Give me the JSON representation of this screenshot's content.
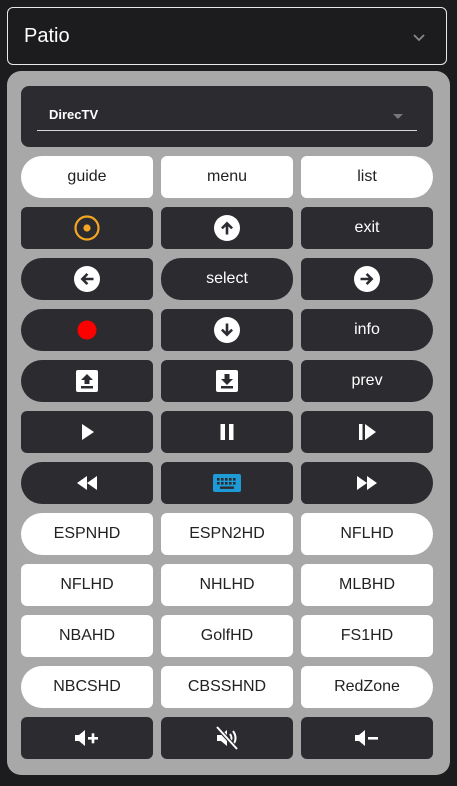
{
  "room": {
    "selected": "Patio"
  },
  "source": {
    "selected": "DirecTV"
  },
  "nav": {
    "guide": "guide",
    "menu": "menu",
    "list": "list"
  },
  "controls": {
    "exit": "exit",
    "select": "select",
    "info": "info",
    "prev": "prev"
  },
  "channels": [
    [
      "ESPNHD",
      "ESPN2HD",
      "NFLHD"
    ],
    [
      "NFLHD",
      "NHLHD",
      "MLBHD"
    ],
    [
      "NBAHD",
      "GolfHD",
      "FS1HD"
    ],
    [
      "NBCSHD",
      "CBSSHND",
      "RedZone"
    ]
  ],
  "colors": {
    "power_ring": "#f5a623",
    "record_dot": "#ff0000",
    "keyboard_icon": "#1e9bd7"
  }
}
